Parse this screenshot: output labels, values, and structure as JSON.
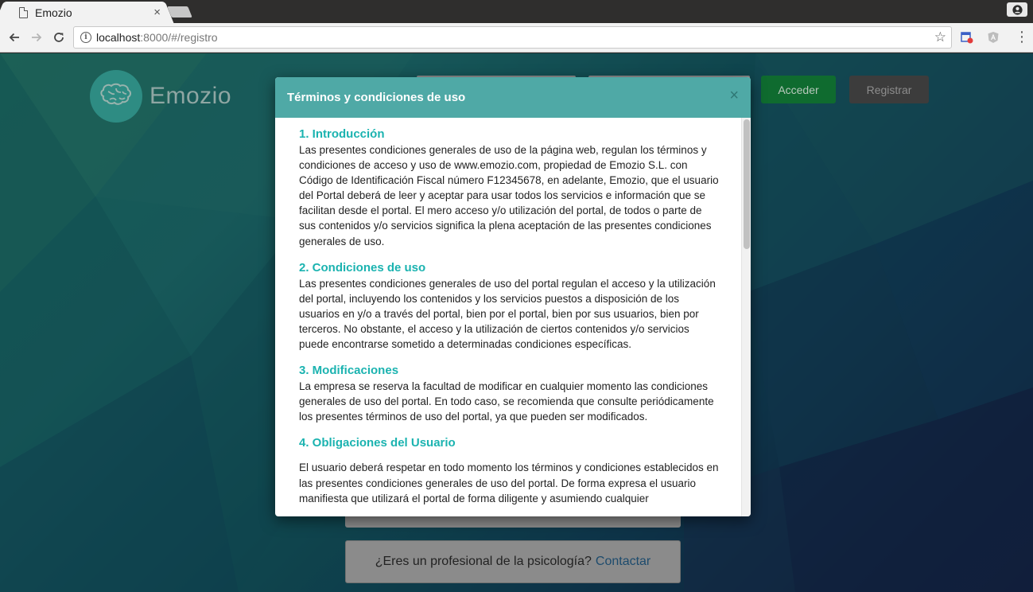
{
  "browser": {
    "tab_title": "Emozio",
    "tab_close": "×",
    "url_host": "localhost",
    "url_rest": ":8000/#/registro",
    "star": "☆",
    "menu": "⋮"
  },
  "page": {
    "logo_text": "Emozio",
    "acceder_label": "Acceder",
    "registrar_label": "Registrar",
    "pro_question": "¿Eres un profesional de la psicología?",
    "pro_link": "Contactar",
    "colors": {
      "teal": "#4fa9a6",
      "heading": "#1bb3b0",
      "green": "#0f6b2f"
    }
  },
  "modal": {
    "title": "Términos y condiciones de uso",
    "close": "×",
    "sections": [
      {
        "title": "1. Introducción",
        "text": "Las presentes condiciones generales de uso de la página web, regulan los términos y condiciones de acceso y uso de www.emozio.com, propiedad de Emozio S.L. con Código de Identificación Fiscal número F12345678, en adelante, Emozio, que el usuario del Portal deberá de leer y aceptar para usar todos los servicios e información que se facilitan desde el portal. El mero acceso y/o utilización del portal, de todos o parte de sus contenidos y/o servicios significa la plena aceptación de las presentes condiciones generales de uso."
      },
      {
        "title": "2. Condiciones de uso",
        "text": "Las presentes condiciones generales de uso del portal regulan el acceso y la utilización del portal, incluyendo los contenidos y los servicios puestos a disposición de los usuarios en y/o a través del portal, bien por el portal, bien por sus usuarios, bien por terceros. No obstante, el acceso y la utilización de ciertos contenidos y/o servicios puede encontrarse sometido a determinadas condiciones específicas."
      },
      {
        "title": "3. Modificaciones",
        "text": "La empresa se reserva la facultad de modificar en cualquier momento las condiciones generales de uso del portal. En todo caso, se recomienda que consulte periódicamente los presentes términos de uso del portal, ya que pueden ser modificados."
      },
      {
        "title": "4. Obligaciones del Usuario",
        "text": "El usuario deberá respetar en todo momento los términos y condiciones establecidos en las presentes condiciones generales de uso del portal. De forma expresa el usuario manifiesta que utilizará el portal de forma diligente y asumiendo cualquier"
      }
    ]
  }
}
